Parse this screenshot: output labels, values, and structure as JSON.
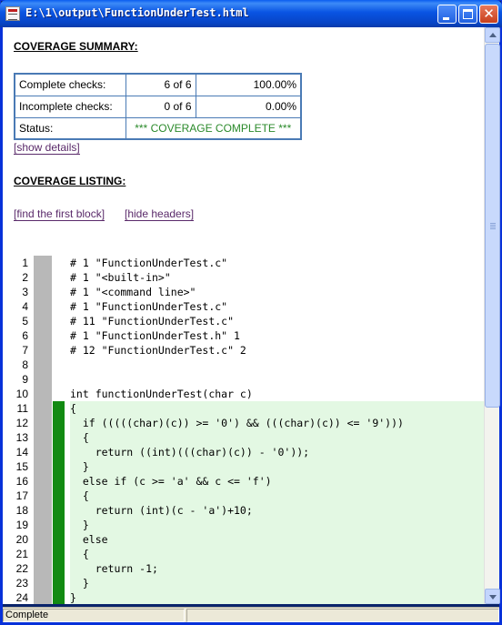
{
  "window": {
    "title": "E:\\1\\output\\FunctionUnderTest.html"
  },
  "summary": {
    "heading": "COVERAGE SUMMARY:",
    "rows": [
      {
        "label": "Complete checks:",
        "count": "6 of 6",
        "percent": "100.00%"
      },
      {
        "label": "Incomplete checks:",
        "count": "0 of 6",
        "percent": "0.00%"
      }
    ],
    "status_label": "Status:",
    "status_value": "*** COVERAGE COMPLETE ***",
    "show_details": "[show details]"
  },
  "listing": {
    "heading": "COVERAGE LISTING:",
    "find_first": "[find the first block]",
    "hide_headers": "[hide headers]",
    "lines": [
      {
        "n": "1",
        "code": "# 1 \"FunctionUnderTest.c\"",
        "covered": false
      },
      {
        "n": "2",
        "code": "# 1 \"<built-in>\"",
        "covered": false
      },
      {
        "n": "3",
        "code": "# 1 \"<command line>\"",
        "covered": false
      },
      {
        "n": "4",
        "code": "# 1 \"FunctionUnderTest.c\"",
        "covered": false
      },
      {
        "n": "5",
        "code": "# 11 \"FunctionUnderTest.c\"",
        "covered": false
      },
      {
        "n": "6",
        "code": "# 1 \"FunctionUnderTest.h\" 1",
        "covered": false
      },
      {
        "n": "7",
        "code": "# 12 \"FunctionUnderTest.c\" 2",
        "covered": false
      },
      {
        "n": "8",
        "code": "",
        "covered": false
      },
      {
        "n": "9",
        "code": "",
        "covered": false
      },
      {
        "n": "10",
        "code": "int functionUnderTest(char c)",
        "covered": false
      },
      {
        "n": "11",
        "code": "{",
        "covered": true
      },
      {
        "n": "12",
        "code": "  if (((((char)(c)) >= '0') && (((char)(c)) <= '9')))",
        "covered": true
      },
      {
        "n": "13",
        "code": "  {",
        "covered": true
      },
      {
        "n": "14",
        "code": "    return ((int)(((char)(c)) - '0'));",
        "covered": true
      },
      {
        "n": "15",
        "code": "  }",
        "covered": true
      },
      {
        "n": "16",
        "code": "  else if (c >= 'a' && c <= 'f')",
        "covered": true
      },
      {
        "n": "17",
        "code": "  {",
        "covered": true
      },
      {
        "n": "18",
        "code": "    return (int)(c - 'a')+10;",
        "covered": true
      },
      {
        "n": "19",
        "code": "  }",
        "covered": true
      },
      {
        "n": "20",
        "code": "  else",
        "covered": true
      },
      {
        "n": "21",
        "code": "  {",
        "covered": true
      },
      {
        "n": "22",
        "code": "    return -1;",
        "covered": true
      },
      {
        "n": "23",
        "code": "  }",
        "covered": true
      },
      {
        "n": "24",
        "code": "}",
        "covered": true
      }
    ]
  },
  "statusbar": {
    "text": "Complete"
  },
  "colors": {
    "covered": "#138a13",
    "uncovered": "#b8b8b8",
    "highlight": "#e3f8e3",
    "status_complete": "#2b8a2b"
  }
}
